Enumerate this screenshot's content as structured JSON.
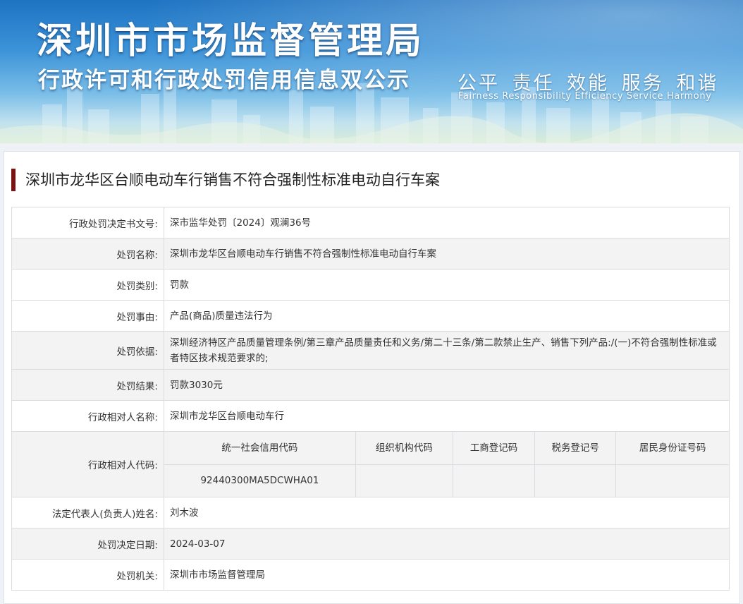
{
  "banner": {
    "title": "深圳市市场监督管理局",
    "subtitle": "行政许可和行政处罚信用信息双公示",
    "slogan_cn": "公平 责任 效能 服务 和谐",
    "slogan_en": "Fairness Responsibility Efficiency Service Harmony"
  },
  "case": {
    "title": "深圳市龙华区台顺电动车行销售不符合强制性标准电动自行车案"
  },
  "fields": {
    "decision_no": {
      "label": "行政处罚决定书文号:",
      "value": "深市监华处罚〔2024〕观澜36号"
    },
    "penalty_name": {
      "label": "处罚名称:",
      "value": "深圳市龙华区台顺电动车行销售不符合强制性标准电动自行车案"
    },
    "penalty_type": {
      "label": "处罚类别:",
      "value": "罚款"
    },
    "penalty_reason": {
      "label": "处罚事由:",
      "value": "产品(商品)质量违法行为"
    },
    "penalty_basis": {
      "label": "处罚依据:",
      "value": "深圳经济特区产品质量管理条例/第三章产品质量责任和义务/第二十三条/第二款禁止生产、销售下列产品:/(一)不符合强制性标准或者特区技术规范要求的;"
    },
    "penalty_result": {
      "label": "处罚结果:",
      "value": "罚款3030元"
    },
    "party_name": {
      "label": "行政相对人名称:",
      "value": "深圳市龙华区台顺电动车行"
    },
    "party_code": {
      "label": "行政相对人代码:",
      "headers": [
        "统一社会信用代码",
        "组织机构代码",
        "工商登记码",
        "税务登记号",
        "居民身份证号码"
      ],
      "values": [
        "92440300MA5DCWHA01",
        "",
        "",
        "",
        ""
      ]
    },
    "legal_rep": {
      "label": "法定代表人(负责人)姓名:",
      "value": "刘木波"
    },
    "decision_date": {
      "label": "处罚决定日期:",
      "value": "2024-03-07"
    },
    "authority": {
      "label": "处罚机关:",
      "value": "深圳市市场监督管理局"
    }
  }
}
